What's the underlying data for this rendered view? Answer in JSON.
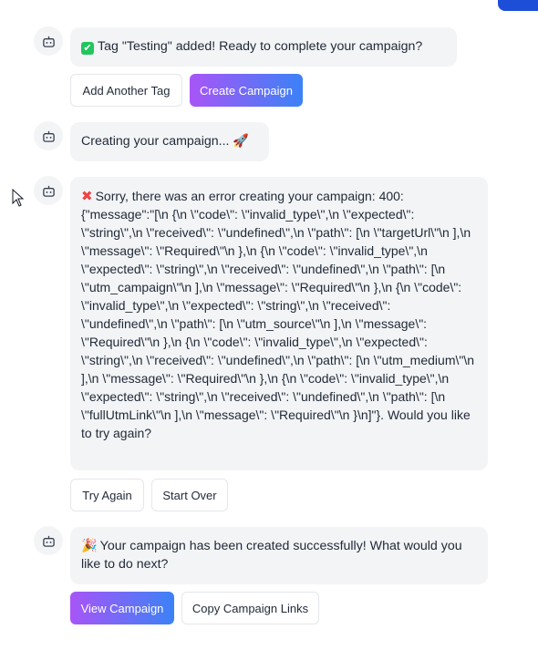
{
  "messages": [
    {
      "icon": "bot-icon",
      "emoji": "✔",
      "text": "Tag \"Testing\" added! Ready to complete your campaign?",
      "actions": [
        "Add Another Tag",
        "Create Campaign"
      ]
    },
    {
      "icon": "bot-icon",
      "text": "Creating your campaign...",
      "emoji": "🚀"
    },
    {
      "icon": "bot-icon",
      "emoji": "✖",
      "text": "Sorry, there was an error creating your campaign: 400: {\"message\":\"[\\n {\\n \\\"code\\\": \\\"invalid_type\\\",\\n \\\"expected\\\": \\\"string\\\",\\n \\\"received\\\": \\\"undefined\\\",\\n \\\"path\\\": [\\n \\\"targetUrl\\\"\\n ],\\n \\\"message\\\": \\\"Required\\\"\\n },\\n {\\n \\\"code\\\": \\\"invalid_type\\\",\\n \\\"expected\\\": \\\"string\\\",\\n \\\"received\\\": \\\"undefined\\\",\\n \\\"path\\\": [\\n \\\"utm_campaign\\\"\\n ],\\n \\\"message\\\": \\\"Required\\\"\\n },\\n {\\n \\\"code\\\": \\\"invalid_type\\\",\\n \\\"expected\\\": \\\"string\\\",\\n \\\"received\\\": \\\"undefined\\\",\\n \\\"path\\\": [\\n \\\"utm_source\\\"\\n ],\\n \\\"message\\\": \\\"Required\\\"\\n },\\n {\\n \\\"code\\\": \\\"invalid_type\\\",\\n \\\"expected\\\": \\\"string\\\",\\n \\\"received\\\": \\\"undefined\\\",\\n \\\"path\\\": [\\n \\\"utm_medium\\\"\\n ],\\n \\\"message\\\": \\\"Required\\\"\\n },\\n {\\n \\\"code\\\": \\\"invalid_type\\\",\\n \\\"expected\\\": \\\"string\\\",\\n \\\"received\\\": \\\"undefined\\\",\\n \\\"path\\\": [\\n \\\"fullUtmLink\\\"\\n ],\\n \\\"message\\\": \\\"Required\\\"\\n }\\n]\"}. Would you like to try again?",
      "actions": [
        "Try Again",
        "Start Over"
      ]
    },
    {
      "icon": "bot-icon",
      "emoji": "🎉",
      "text": "Your campaign has been created successfully! What would you like to do next?",
      "actions": [
        "View Campaign",
        "Copy Campaign Links"
      ]
    }
  ],
  "colors": {
    "gradient_start": "#a855f7",
    "gradient_end": "#3b82f6",
    "bubble_bg": "#f3f4f6",
    "error": "#ef4444",
    "success": "#22c55e"
  }
}
